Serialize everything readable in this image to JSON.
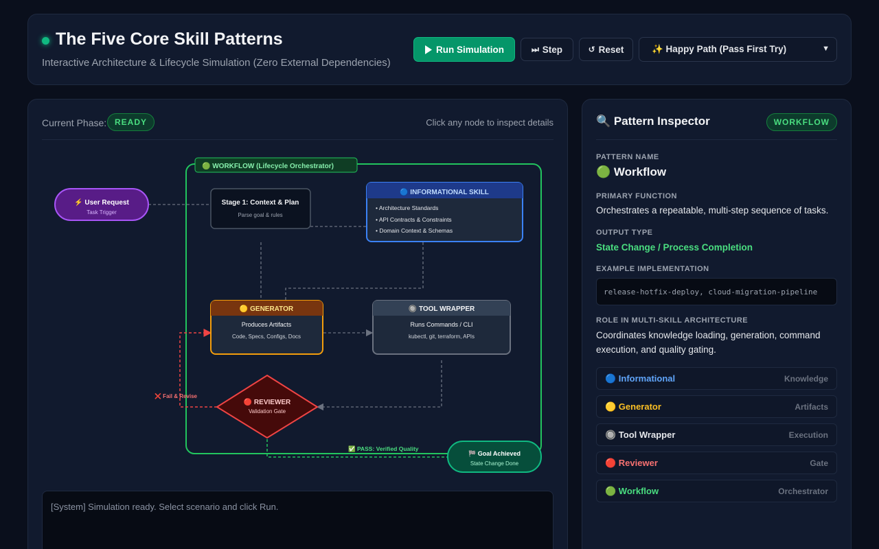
{
  "header": {
    "title": "The Five Core Skill Patterns",
    "subtitle": "Interactive Architecture & Lifecycle Simulation (Zero External Dependencies)",
    "run_label": "Run Simulation",
    "step_label": "Step",
    "reset_label": "Reset",
    "scenario_selected": "✨ Happy Path (Pass First Try)"
  },
  "simulation": {
    "phase_label": "Current Phase:",
    "phase_value": "READY",
    "hint": "Click any node to inspect details",
    "log_text": "[System] Simulation ready. Select scenario and click Run."
  },
  "diagram": {
    "workflow_label": "🟢 WORKFLOW (Lifecycle Orchestrator)",
    "user_request": {
      "title": "⚡ User Request",
      "subtitle": "Task Trigger"
    },
    "stage1": {
      "title": "Stage 1: Context & Plan",
      "subtitle": "Parse goal & rules"
    },
    "informational": {
      "title": "🔵 INFORMATIONAL SKILL",
      "items": [
        "• Architecture Standards",
        "• API Contracts & Constraints",
        "• Domain Context & Schemas"
      ]
    },
    "generator": {
      "title": "🟡 GENERATOR",
      "line1": "Produces Artifacts",
      "line2": "Code, Specs, Configs, Docs"
    },
    "tool_wrapper": {
      "title": "🔘 TOOL WRAPPER",
      "line1": "Runs Commands / CLI",
      "line2": "kubectl, git, terraform, APIs"
    },
    "reviewer": {
      "title": "🔴 REVIEWER",
      "subtitle": "Validation Gate"
    },
    "fail_label": "❌ Fail & Revise",
    "pass_label": "✅ PASS: Verified Quality",
    "goal": {
      "title": "🏁 Goal Achieved",
      "subtitle": "State Change Done"
    }
  },
  "inspector": {
    "title": "🔍 Pattern Inspector",
    "badge": "WORKFLOW",
    "pattern_name_label": "Pattern Name",
    "pattern_name": "🟢 Workflow",
    "primary_function_label": "Primary Function",
    "primary_function": "Orchestrates a repeatable, multi-step sequence of tasks.",
    "output_type_label": "Output Type",
    "output_type": "State Change / Process Completion",
    "example_label": "Example Implementation",
    "example": "release-hotfix-deploy, cloud-migration-pipeline",
    "role_label": "Role in Multi-Skill Architecture",
    "role": "Coordinates knowledge loading, generation, command execution, and quality gating.",
    "legend": [
      {
        "name": "🔵 Informational",
        "role": "Knowledge",
        "color": "#60a5fa"
      },
      {
        "name": "🟡 Generator",
        "role": "Artifacts",
        "color": "#fbbf24"
      },
      {
        "name": "🔘 Tool Wrapper",
        "role": "Execution",
        "color": "#e5e7eb"
      },
      {
        "name": "🔴 Reviewer",
        "role": "Gate",
        "color": "#f87171"
      },
      {
        "name": "🟢 Workflow",
        "role": "Orchestrator",
        "color": "#4ade80"
      }
    ]
  }
}
